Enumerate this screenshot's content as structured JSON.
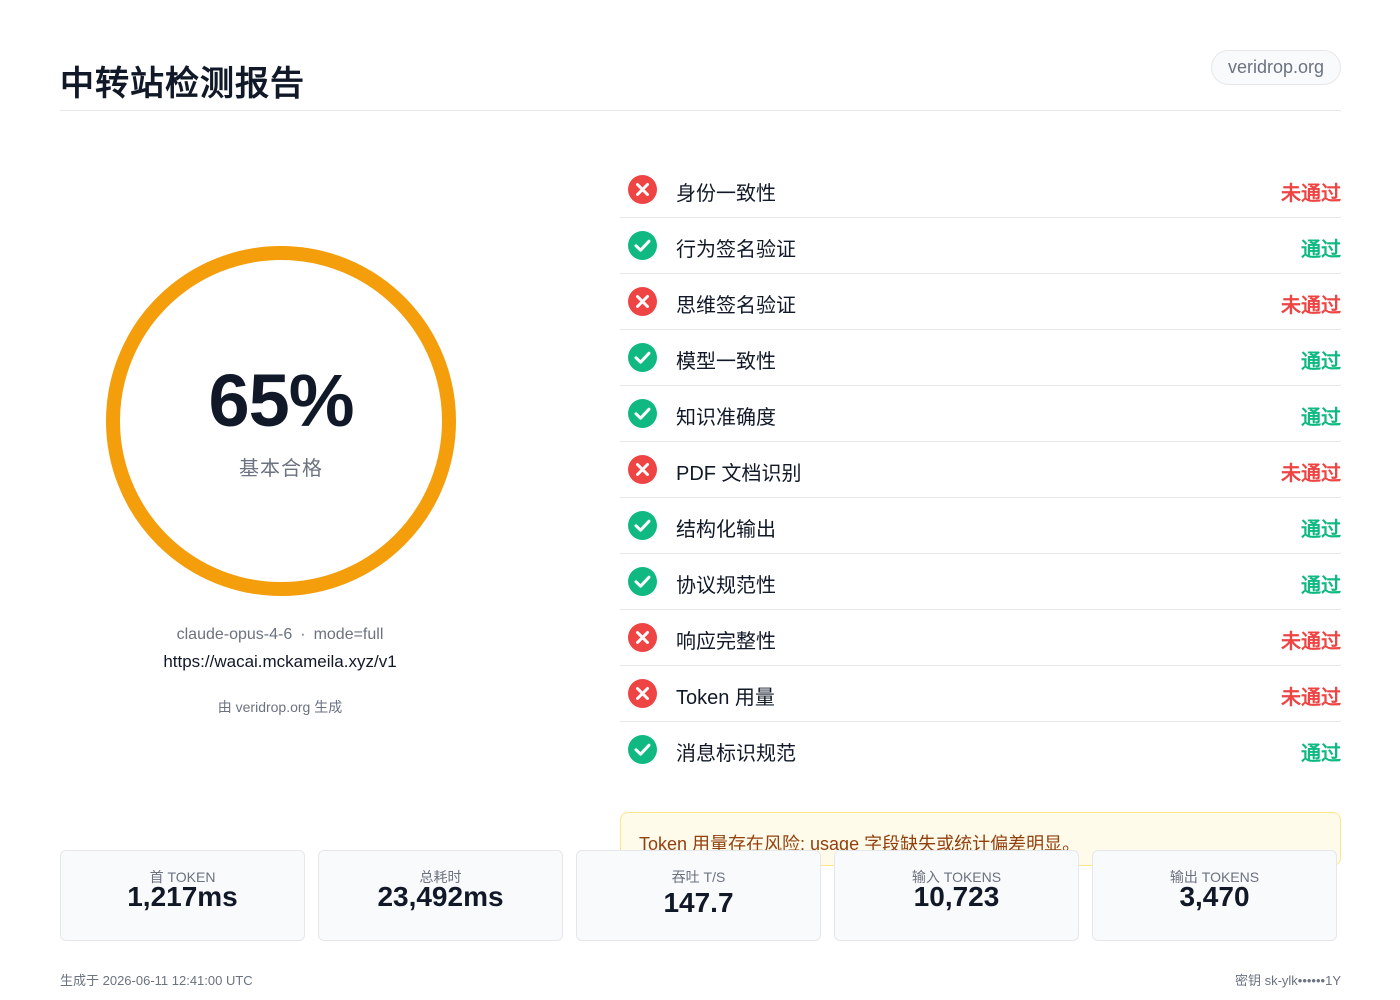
{
  "header": {
    "title": "中转站检测报告",
    "domain_badge": "veridrop.org"
  },
  "score": {
    "percent": 65,
    "percent_label": "65%",
    "grade": "基本合格",
    "ring_color": "#f59e0b"
  },
  "meta": {
    "model": "claude-opus-4-6",
    "separator": "·",
    "mode": "mode=full",
    "endpoint": "https://wacai.mckameila.xyz/v1",
    "generated_by": "由 veridrop.org 生成"
  },
  "checks": [
    {
      "name": "身份一致性",
      "status": "fail",
      "result": "未通过"
    },
    {
      "name": "行为签名验证",
      "status": "pass",
      "result": "通过"
    },
    {
      "name": "思维签名验证",
      "status": "fail",
      "result": "未通过"
    },
    {
      "name": "模型一致性",
      "status": "pass",
      "result": "通过"
    },
    {
      "name": "知识准确度",
      "status": "pass",
      "result": "通过"
    },
    {
      "name": "PDF 文档识别",
      "status": "fail",
      "result": "未通过"
    },
    {
      "name": "结构化输出",
      "status": "pass",
      "result": "通过"
    },
    {
      "name": "协议规范性",
      "status": "pass",
      "result": "通过"
    },
    {
      "name": "响应完整性",
      "status": "fail",
      "result": "未通过"
    },
    {
      "name": "Token 用量",
      "status": "fail",
      "result": "未通过"
    },
    {
      "name": "消息标识规范",
      "status": "pass",
      "result": "通过"
    }
  ],
  "warning": {
    "text": "Token 用量存在风险: usage 字段缺失或统计偏差明显。"
  },
  "stats": [
    {
      "label": "首 TOKEN",
      "value": "1,217ms"
    },
    {
      "label": "总耗时",
      "value": "23,492ms"
    },
    {
      "label": "吞吐 T/S",
      "value": "147.7"
    },
    {
      "label": "输入 TOKENS",
      "value": "10,723"
    },
    {
      "label": "输出 TOKENS",
      "value": "3,470"
    }
  ],
  "footer": {
    "generated_at": "生成于 2026-06-11 12:41:00 UTC",
    "key": "密钥 sk-ylk••••••1Y"
  },
  "colors": {
    "pass": "#10b981",
    "fail": "#ef4444",
    "accent": "#f59e0b",
    "warning_bg": "#fffbeb"
  }
}
